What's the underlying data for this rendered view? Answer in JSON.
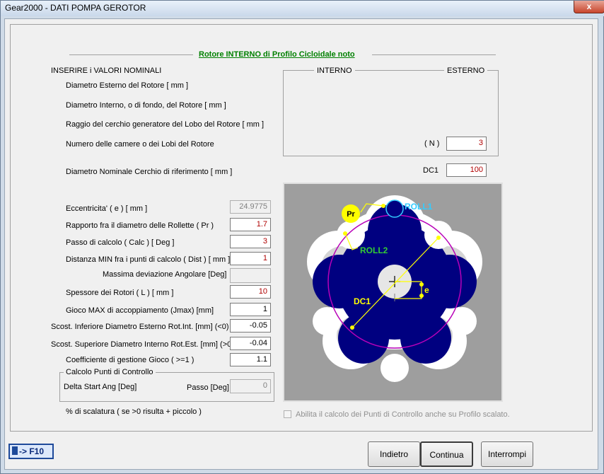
{
  "window": {
    "title": "Gear2000 - DATI POMPA GEROTOR",
    "close_glyph": "x"
  },
  "header": {
    "section_title": "Rotore INTERNO di Profilo Cicloidale noto"
  },
  "nominal": {
    "heading": "INSERIRE i VALORI NOMINALI",
    "fields": [
      "Diametro Esterno del Rotore [ mm ]",
      "Diametro Interno, o di fondo, del Rotore [ mm ]",
      "Raggio del cerchio generatore del Lobo del Rotore [ mm ]",
      "Numero delle camere o dei Lobi del Rotore"
    ],
    "diametro_label": "Diametro Nominale Cerchio di riferimento [ mm ]"
  },
  "columns": {
    "interno": "INTERNO",
    "esterno": "ESTERNO"
  },
  "n_field": {
    "label": "( N )",
    "value": "3"
  },
  "dc1_field": {
    "label": "DC1",
    "value": "100"
  },
  "params": [
    {
      "label": "Eccentricita'  ( e ) [ mm ]",
      "value": "24.9775"
    },
    {
      "label": "Rapporto fra il diametro delle Rollette ( Pr )",
      "value": "1.7"
    },
    {
      "label": "Passo di calcolo ( Calc ) [ Deg ]",
      "value": "3"
    },
    {
      "label": "Distanza MIN fra i punti di calcolo ( Dist ) [ mm ]",
      "value": "1"
    },
    {
      "label": "Massima deviazione Angolare [Deg]",
      "value": ""
    },
    {
      "label": "Spessore dei Rotori ( L ) [ mm ]",
      "value": "10"
    },
    {
      "label": "Gioco MAX di accoppiamento (Jmax) [mm]",
      "value": "1"
    },
    {
      "label": "Scost. Inferiore Diametro Esterno Rot.Int. [mm] (<0)",
      "value": "-0.05"
    },
    {
      "label": "Scost. Superiore Diametro Interno Rot.Est. [mm] (>0)",
      "value": "-0.04"
    },
    {
      "label": "Coefficiente di gestione Gioco ( >=1 )",
      "value": "1.1"
    }
  ],
  "calc_group": {
    "title": "Calcolo Punti di Controllo",
    "delta_label": "Delta Start Ang [Deg]",
    "passo_label": "Passo [Deg]",
    "passo_value": "0"
  },
  "scalatura_label": "% di scalatura ( se >0 risulta + piccolo )",
  "checkbox_label": "Abilita il calcolo dei Punti di Controllo anche su Profilo scalato.",
  "diagram": {
    "labels": {
      "pr": "Pr",
      "roll1": "ROLL1",
      "roll2": "ROLL2",
      "dc1": "DC1",
      "e": "e"
    },
    "colors": {
      "background": "#9e9e9e",
      "rotor": "#000080",
      "circle": "#b800b8",
      "accent": "#ffff00",
      "roll1": "#33ccff",
      "roll2": "#33cc33"
    }
  },
  "footer": {
    "f10_label": "-> F10",
    "buttons": {
      "indietro": "Indietro",
      "continua": "Continua",
      "interrompi": "Interrompi"
    }
  }
}
